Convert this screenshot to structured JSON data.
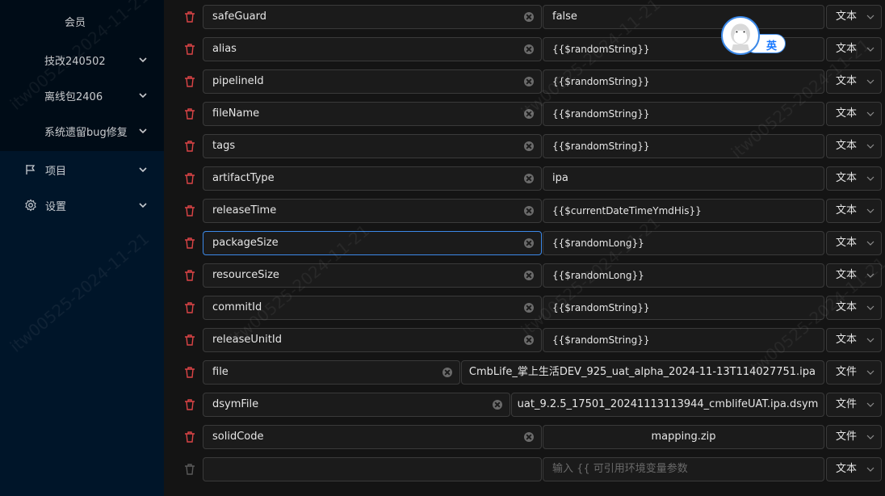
{
  "sidebar": {
    "items": [
      {
        "label": "会员"
      },
      {
        "label": "技改240502"
      },
      {
        "label": "离线包2406"
      },
      {
        "label": "系统遗留bug修复"
      },
      {
        "label": "项目"
      },
      {
        "label": "设置"
      }
    ]
  },
  "params": {
    "rows": [
      {
        "key": "safeGuard",
        "value": "false",
        "type": "文本"
      },
      {
        "key": "alias",
        "value": "{{$randomString}}",
        "type": "文本"
      },
      {
        "key": "pipelineId",
        "value": "{{$randomString}}",
        "type": "文本"
      },
      {
        "key": "fileName",
        "value": "{{$randomString}}",
        "type": "文本"
      },
      {
        "key": "tags",
        "value": "{{$randomString}}",
        "type": "文本"
      },
      {
        "key": "artifactType",
        "value": "ipa",
        "type": "文本"
      },
      {
        "key": "releaseTime",
        "value": "{{$currentDateTimeYmdHis}}",
        "type": "文本"
      },
      {
        "key": "packageSize",
        "value": "{{$randomLong}}",
        "type": "文本"
      },
      {
        "key": "resourceSize",
        "value": "{{$randomLong}}",
        "type": "文本"
      },
      {
        "key": "commitId",
        "value": "{{$randomString}}",
        "type": "文本"
      },
      {
        "key": "releaseUnitId",
        "value": "{{$randomString}}",
        "type": "文本"
      },
      {
        "key": "file",
        "value": "CmbLife_掌上生活DEV_925_uat_alpha_2024-11-13T114027751.ipa",
        "type": "文件"
      },
      {
        "key": "dsymFile",
        "value": "uat_9.2.5_17501_20241113113944_cmblifeUAT.ipa.dsym",
        "type": "文件"
      },
      {
        "key": "solidCode",
        "value": "mapping.zip",
        "type": "文件"
      },
      {
        "key": "",
        "placeholder": "输入 {{ 可引用环境变量参数",
        "type": "文本"
      }
    ]
  },
  "ime": {
    "label": "英"
  },
  "watermark": {
    "text": "itw00525-2024-11-21"
  },
  "colors": {
    "danger": "#dc4446",
    "accent": "#1677ff",
    "sidebar": "#001529"
  }
}
